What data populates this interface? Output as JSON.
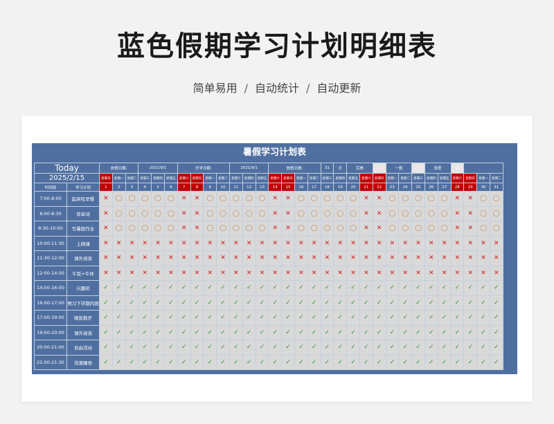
{
  "page": {
    "title": "蓝色假期学习计划明细表",
    "subtitle_parts": [
      "简单易用",
      "自动统计",
      "自动更新"
    ],
    "separator": "/"
  },
  "sheet": {
    "title": "暑假学习计划表",
    "today_label": "Today",
    "today_date": "2025/2/15",
    "header_time": "时间段",
    "header_plan": "学习计划",
    "vacation_start_label": "放假日期:",
    "vacation_start": "2021/9/1",
    "school_start_label": "开学日期:",
    "school_start": "2021/9/1",
    "vacation_days_label": "放假天数:",
    "vacation_days": "31",
    "days_unit": "天",
    "legend": [
      {
        "label": "完美",
        "symbol": "✓"
      },
      {
        "label": "一般",
        "symbol": "◯"
      },
      {
        "label": "较差",
        "symbol": "✕"
      }
    ],
    "weekdays": [
      "星期日",
      "星期一",
      "星期二",
      "星期三",
      "星期四",
      "星期五",
      "星期六",
      "星期日",
      "星期一",
      "星期二",
      "星期三",
      "星期四",
      "星期五",
      "星期六",
      "星期日",
      "星期一",
      "星期二",
      "星期三",
      "星期四",
      "星期五",
      "星期六",
      "星期日",
      "星期一",
      "星期二",
      "星期三",
      "星期四",
      "星期五",
      "星期六",
      "星期日",
      "星期一",
      "星期二"
    ],
    "weekend_days": [
      1,
      7,
      8,
      14,
      15,
      21,
      22,
      28,
      29
    ],
    "days": [
      "1",
      "2",
      "3",
      "4",
      "5",
      "6",
      "7",
      "8",
      "9",
      "10",
      "11",
      "12",
      "13",
      "14",
      "15",
      "16",
      "17",
      "18",
      "19",
      "20",
      "21",
      "22",
      "23",
      "24",
      "25",
      "26",
      "27",
      "28",
      "29",
      "30",
      "31"
    ],
    "rows": [
      {
        "time": "7:00-8:00",
        "activity": "起床吃早餐",
        "pattern": "o"
      },
      {
        "time": "8:00-8:30",
        "activity": "背单词",
        "pattern": "o"
      },
      {
        "time": "8:30-10:00",
        "activity": "写暑假作业",
        "pattern": "o"
      },
      {
        "time": "10:00-11:30",
        "activity": "上网课",
        "pattern": "x"
      },
      {
        "time": "11:30-12:00",
        "activity": "课外阅读",
        "pattern": "x"
      },
      {
        "time": "12:00-14:00",
        "activity": "午饭+午休",
        "pattern": "x"
      },
      {
        "time": "14:00-16:00",
        "activity": "兴趣班",
        "pattern": "c"
      },
      {
        "time": "16:00-17:00",
        "activity": "预习下学期内容",
        "pattern": "c"
      },
      {
        "time": "17:00-19:00",
        "activity": "晚饭散步",
        "pattern": "c"
      },
      {
        "time": "19:00-20:00",
        "activity": "课外阅读",
        "pattern": "c"
      },
      {
        "time": "20:00-21:00",
        "activity": "自由活动",
        "pattern": "c"
      },
      {
        "time": "21:00-21:30",
        "activity": "洗漱睡觉",
        "pattern": "c"
      }
    ],
    "marks": {
      "o": "◯",
      "x": "✕",
      "c": "✓"
    }
  }
}
